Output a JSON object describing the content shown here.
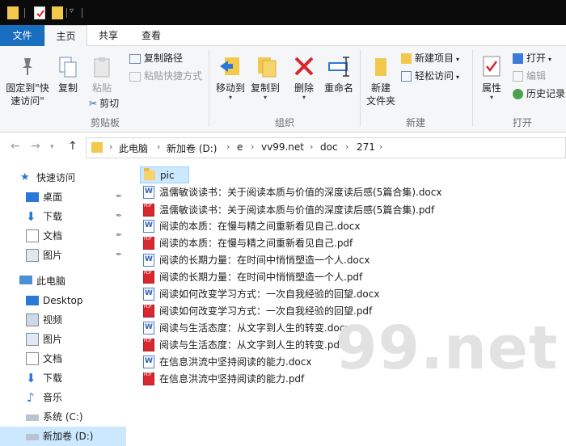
{
  "tabs": [
    {
      "label": "文件"
    },
    {
      "label": "主页"
    },
    {
      "label": "共享"
    },
    {
      "label": "查看"
    }
  ],
  "ribbon": {
    "clipboard": {
      "pin_label": "固定到\"快\n速访问\"",
      "copy_label": "复制",
      "paste_label": "粘贴",
      "copy_path_label": "复制路径",
      "paste_shortcut_label": "粘贴快捷方式",
      "cut_label": "剪切",
      "group_label": "剪贴板"
    },
    "organize": {
      "move_to_label": "移动到",
      "copy_to_label": "复制到",
      "delete_label": "删除",
      "rename_label": "重命名",
      "group_label": "组织"
    },
    "new": {
      "new_folder_label": "新建\n文件夹",
      "new_item_label": "新建项目",
      "easy_access_label": "轻松访问",
      "group_label": "新建"
    },
    "open": {
      "properties_label": "属性",
      "open_label": "打开",
      "edit_label": "编辑",
      "history_label": "历史记录",
      "group_label": "打开"
    }
  },
  "breadcrumb": [
    "此电脑",
    "新加卷 (D:)",
    "e",
    "vv99.net",
    "doc",
    "271"
  ],
  "nav": {
    "quick_access": "快速访问",
    "quick_items": [
      "桌面",
      "下载",
      "文档",
      "图片"
    ],
    "this_pc": "此电脑",
    "pc_items": [
      "Desktop",
      "视频",
      "图片",
      "文档",
      "下载",
      "音乐",
      "系统 (C:)",
      "新加卷 (D:)"
    ]
  },
  "files": [
    {
      "name": "pic",
      "type": "folder"
    },
    {
      "name": "温儒敏谈读书：关于阅读本质与价值的深度读后感(5篇合集).docx",
      "type": "docx"
    },
    {
      "name": "温儒敏谈读书：关于阅读本质与价值的深度读后感(5篇合集).pdf",
      "type": "pdf"
    },
    {
      "name": "阅读的本质：在慢与精之间重新看见自己.docx",
      "type": "docx"
    },
    {
      "name": "阅读的本质：在慢与精之间重新看见自己.pdf",
      "type": "pdf"
    },
    {
      "name": "阅读的长期力量：在时间中悄悄塑造一个人.docx",
      "type": "docx"
    },
    {
      "name": "阅读的长期力量：在时间中悄悄塑造一个人.pdf",
      "type": "pdf"
    },
    {
      "name": "阅读如何改变学习方式：一次自我经验的回望.docx",
      "type": "docx"
    },
    {
      "name": "阅读如何改变学习方式：一次自我经验的回望.pdf",
      "type": "pdf"
    },
    {
      "name": "阅读与生活态度：从文字到人生的转变.docx",
      "type": "docx"
    },
    {
      "name": "阅读与生活态度：从文字到人生的转变.pdf",
      "type": "pdf"
    },
    {
      "name": "在信息洪流中坚持阅读的能力.docx",
      "type": "docx"
    },
    {
      "name": "在信息洪流中坚持阅读的能力.pdf",
      "type": "pdf"
    }
  ],
  "watermark": "99.net",
  "colors": {
    "accent": "#1a6ec0",
    "selection": "#cce8ff",
    "pdf": "#d8282f",
    "docx": "#2b5fc3",
    "folder": "#f7d36b"
  }
}
